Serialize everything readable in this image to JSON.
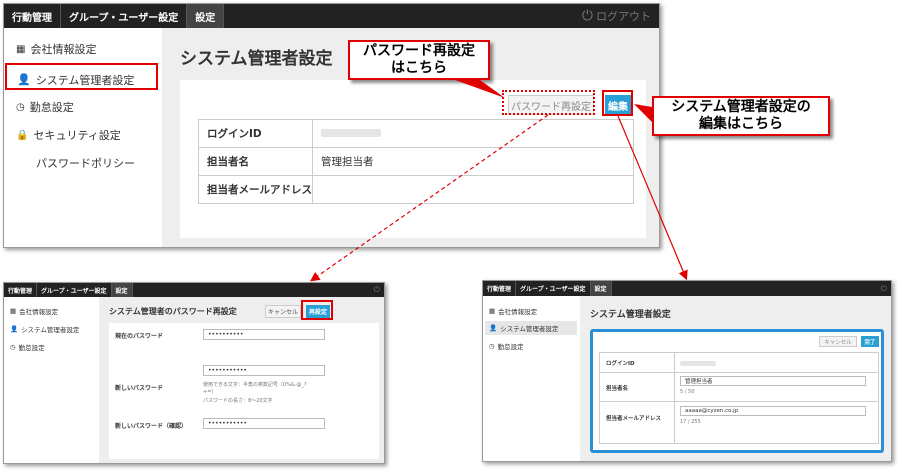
{
  "nav": {
    "activity": "行動管理",
    "group_user": "グループ・ユーザー設定",
    "settings": "設定",
    "logout": "ログアウト"
  },
  "sidebar": {
    "company": "会社情報設定",
    "sysadmin": "システム管理者設定",
    "attendance": "勤怠設定",
    "security": "セキュリティ設定",
    "password_policy": "パスワードポリシー"
  },
  "main": {
    "title": "システム管理者設定",
    "reset_button": "パスワード再設定",
    "edit_button": "編集",
    "rows": [
      {
        "label": "ログインID",
        "value": ""
      },
      {
        "label": "担当者名",
        "value": "管理担当者"
      },
      {
        "label": "担当者メールアドレス",
        "value": ""
      }
    ]
  },
  "callouts": {
    "password_line1": "パスワード再設定",
    "password_line2": "はこちら",
    "edit_line1": "システム管理者設定の",
    "edit_line2": "編集はこちら"
  },
  "pw_screen": {
    "title": "システム管理者のパスワード再設定",
    "cancel": "キャンセル",
    "reset": "再設定",
    "current_label": "現在のパスワード",
    "current_value": "••••••••••",
    "new_label": "新しいパスワード",
    "new_value": "•••••••••••",
    "hint1": "使用できる文字：半角の英数記号（0%&.@_?",
    "hint2": "+=)",
    "hint3": "パスワードの長さ：8〜20文字",
    "confirm_label": "新しいパスワード（確認）",
    "confirm_value": "•••••••••••"
  },
  "edit_screen": {
    "title": "システム管理者設定",
    "cancel": "キャンセル",
    "done": "完了",
    "login_label": "ログインID",
    "name_label": "担当者名",
    "name_value": "管理担当者",
    "name_count": "5 / 50",
    "email_label": "担当者メールアドレス",
    "email_value": "aaaaa@cyzen.co.jp",
    "email_count": "17 / 255"
  }
}
